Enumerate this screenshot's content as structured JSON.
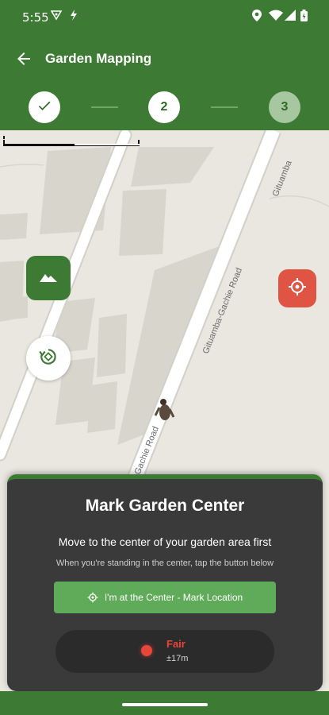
{
  "status_bar": {
    "time": "5:55",
    "icons": [
      "vpn-key-icon",
      "flash-icon",
      "location-icon",
      "wifi-icon",
      "signal-icon",
      "battery-icon"
    ]
  },
  "app_bar": {
    "title": "Garden Mapping",
    "back_icon": "arrow-back-icon"
  },
  "stepper": {
    "steps": [
      {
        "label": "",
        "state": "completed",
        "icon": "check-icon"
      },
      {
        "label": "2",
        "state": "active"
      },
      {
        "label": "3",
        "state": "pending"
      }
    ]
  },
  "map": {
    "roads": [
      "Gituamba",
      "Gituamba-Gachie Road",
      "Gachie Road"
    ],
    "buttons": [
      "layers-icon",
      "rotate-icon",
      "my-location-icon"
    ]
  },
  "sheet": {
    "title": "Mark Garden Center",
    "subtitle": "Move to the center of your garden area first",
    "hint": "When you're standing in the center, tap the button below",
    "mark_button_label": "I'm at the Center - Mark Location",
    "accuracy_level": "Fair",
    "accuracy_range": "±17m"
  },
  "colors": {
    "brand_green": "#3d7a33",
    "button_green": "#5fab5a",
    "alert_red": "#e05444",
    "sheet_bg": "#3a3a3a"
  }
}
